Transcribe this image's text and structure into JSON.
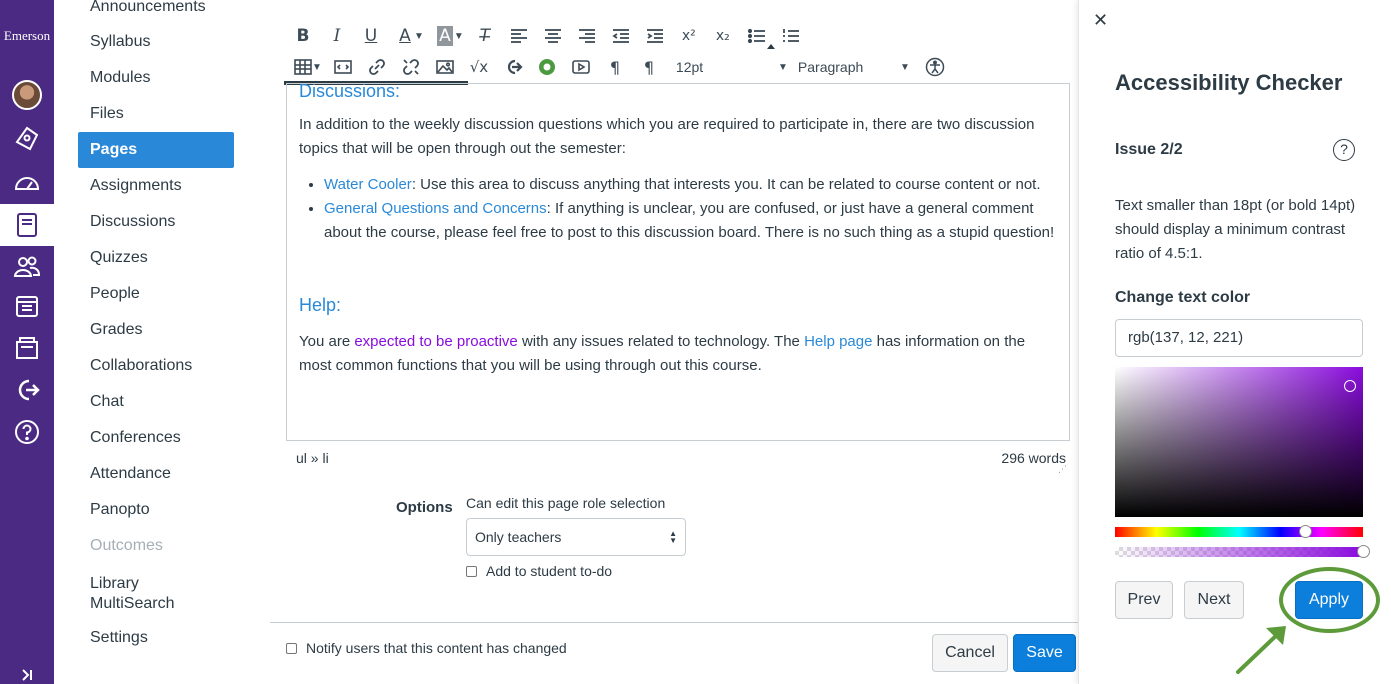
{
  "global_nav": {
    "brand": "Emerson",
    "items": [
      {
        "icon": "account-avatar-icon"
      },
      {
        "icon": "admin-shield-icon"
      },
      {
        "icon": "dashboard-icon"
      },
      {
        "icon": "courses-book-icon",
        "active": true
      },
      {
        "icon": "groups-icon"
      },
      {
        "icon": "calendar-icon"
      },
      {
        "icon": "inbox-icon"
      },
      {
        "icon": "commons-arrow-icon"
      },
      {
        "icon": "help-icon"
      }
    ]
  },
  "course_nav": {
    "items": [
      "Announcements",
      "Syllabus",
      "Modules",
      "Files",
      "Pages",
      "Assignments",
      "Discussions",
      "Quizzes",
      "People",
      "Grades",
      "Collaborations",
      "Chat",
      "Conferences",
      "Attendance",
      "Panopto",
      "Outcomes",
      "Library MultiSearch",
      "Settings"
    ],
    "active": "Pages",
    "disabled": "Outcomes"
  },
  "toolbar": {
    "font_size": "12pt",
    "block_format": "Paragraph"
  },
  "content": {
    "heading_discussions": "Discussions:",
    "para1": "In addition to the weekly discussion questions which you are required to participate in, there are two discussion topics that will be open through out the semester:",
    "li1_link": "Water Cooler",
    "li1_text": ": Use this area to discuss anything that interests you. It can be related to course content or not.",
    "li2_link": "General Questions and Concerns",
    "li2_text": ": If anything is unclear, you are confused, or just have a general comment about the course, please feel free to post to this discussion board. There is no such thing as a stupid question!",
    "heading_help": "Help:",
    "help_pre": "You are ",
    "help_purple": "expected to be proactive",
    "help_mid": " with any issues related to technology. The ",
    "help_link": "Help page",
    "help_post": " has information on the most common functions that you will be using through out this course."
  },
  "status_bar": {
    "path": "ul » li",
    "word_count": "296 words"
  },
  "options": {
    "label": "Options",
    "role_label": "Can edit this page role selection",
    "role_value": "Only teachers",
    "todo_label": "Add to student to-do"
  },
  "footer": {
    "notify_label": "Notify users that this content has changed",
    "cancel": "Cancel",
    "save": "Save"
  },
  "a11y_checker": {
    "title": "Accessibility Checker",
    "issue": "Issue 2/2",
    "message": "Text smaller than 18pt (or bold 14pt) should display a minimum contrast ratio of 4.5:1.",
    "change_label": "Change text color",
    "color_value": "rgb(137, 12, 221)",
    "hue_fraction": 0.77,
    "alpha_fraction": 1.0,
    "prev": "Prev",
    "next": "Next",
    "apply": "Apply",
    "colors": {
      "selected": "#8a0cdd",
      "highlight": "#5d9a3a",
      "primary": "#0b7fdb"
    }
  }
}
